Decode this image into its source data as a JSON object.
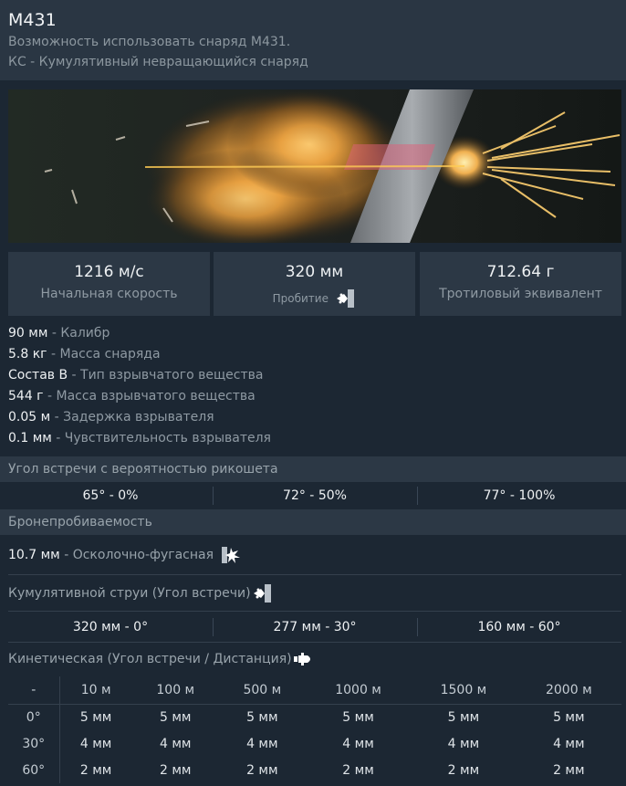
{
  "header": {
    "title": "M431",
    "line1": "Возможность использовать снаряд M431.",
    "line2": "КС - Кумулятивный невращающийся снаряд"
  },
  "stats": [
    {
      "value": "1216 м/с",
      "label": "Начальная скорость"
    },
    {
      "value": "320 мм",
      "label": "Пробитие"
    },
    {
      "value": "712.64 г",
      "label": "Тротиловый эквивалент"
    }
  ],
  "props": [
    {
      "value": "90 мм",
      "label": " - Калибр"
    },
    {
      "value": "5.8 кг",
      "label": " - Масса снаряда"
    },
    {
      "value": "Состав B",
      "label": " - Тип взрывчатого вещества"
    },
    {
      "value": "544 г",
      "label": " - Масса взрывчатого вещества"
    },
    {
      "value": "0.05 м",
      "label": " - Задержка взрывателя"
    },
    {
      "value": "0.1 мм",
      "label": " - Чувствительность взрывателя"
    }
  ],
  "ricochet": {
    "title": "Угол встречи с вероятностью рикошета",
    "values": [
      "65° - 0%",
      "72° - 50%",
      "77° - 100%"
    ]
  },
  "armor": {
    "title": "Бронепробиваемость",
    "he_value": "10.7 мм",
    "he_label": " - Осколочно-фугасная",
    "cumulative_title": "Кумулятивной струи (Угол встречи)",
    "cumulative_values": [
      "320 мм - 0°",
      "277 мм - 30°",
      "160 мм - 60°"
    ],
    "kinetic_title": "Кинетическая (Угол встречи / Дистанция)"
  },
  "kinetic_table": {
    "corner": "-",
    "distances": [
      "10 м",
      "100 м",
      "500 м",
      "1000 м",
      "1500 м",
      "2000 м"
    ],
    "rows": [
      {
        "angle": "0°",
        "values": [
          "5 мм",
          "5 мм",
          "5 мм",
          "5 мм",
          "5 мм",
          "5 мм"
        ]
      },
      {
        "angle": "30°",
        "values": [
          "4 мм",
          "4 мм",
          "4 мм",
          "4 мм",
          "4 мм",
          "4 мм"
        ]
      },
      {
        "angle": "60°",
        "values": [
          "2 мм",
          "2 мм",
          "2 мм",
          "2 мм",
          "2 мм",
          "2 мм"
        ]
      }
    ]
  },
  "icons": {
    "penetration": "shaped-charge-icon",
    "he": "explosion-icon",
    "cumulative": "shaped-charge-icon",
    "kinetic": "shell-icon"
  }
}
